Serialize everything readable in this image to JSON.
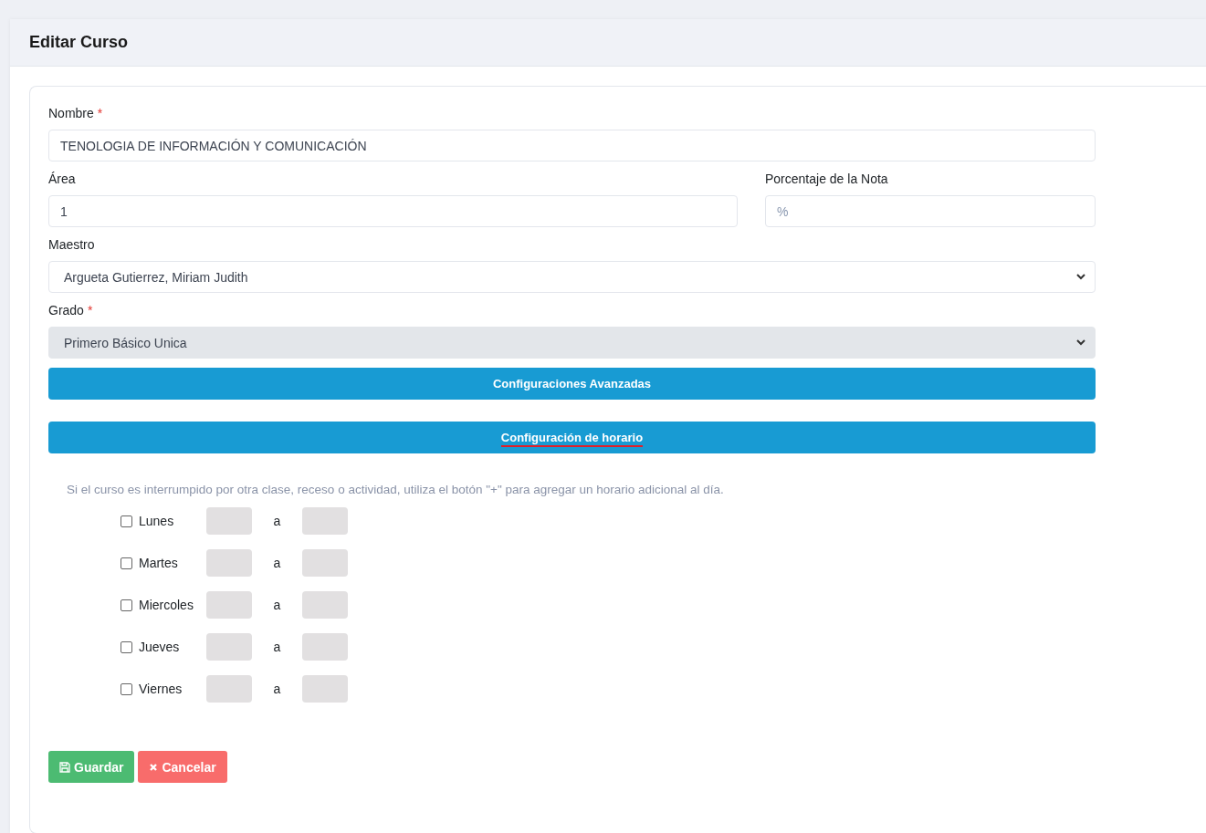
{
  "title": "Editar Curso",
  "nombre": {
    "label": "Nombre",
    "required_mark": "*",
    "value": "TENOLOGIA DE INFORMACIÓN Y COMUNICACIÓN"
  },
  "area": {
    "label": "Área",
    "value": "1"
  },
  "porcentaje": {
    "label": "Porcentaje de la Nota",
    "placeholder": "%"
  },
  "maestro": {
    "label": "Maestro",
    "value": "Argueta Gutierrez, Miriam Judith",
    "disabled": false
  },
  "grado": {
    "label": "Grado",
    "required_mark": "*",
    "value": "Primero Básico Unica",
    "disabled": true
  },
  "advanced_button": "Configuraciones Avanzadas",
  "schedule_button": "Configuración de horario",
  "note": "Si el curso es interrumpido por otra clase, receso o actividad, utiliza el botón \"+\" para agregar un horario adicional al día.",
  "days": [
    {
      "label": "Lunes",
      "checked": false,
      "separator": "a"
    },
    {
      "label": "Martes",
      "checked": false,
      "separator": "a"
    },
    {
      "label": "Miercoles",
      "checked": false,
      "separator": "a"
    },
    {
      "label": "Jueves",
      "checked": false,
      "separator": "a"
    },
    {
      "label": "Viernes",
      "checked": false,
      "separator": "a"
    }
  ],
  "save_button": "Guardar",
  "cancel_button": "Cancelar"
}
